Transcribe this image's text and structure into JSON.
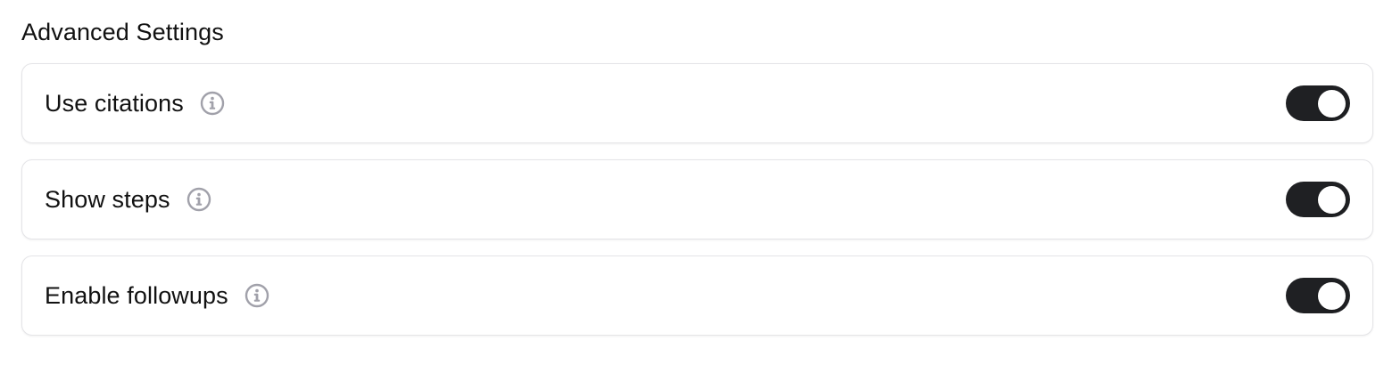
{
  "section": {
    "title": "Advanced Settings"
  },
  "settings": [
    {
      "label": "Use citations",
      "info_icon": "info-icon",
      "enabled": true
    },
    {
      "label": "Show steps",
      "info_icon": "info-icon",
      "enabled": true
    },
    {
      "label": "Enable followups",
      "info_icon": "info-icon",
      "enabled": true
    }
  ],
  "colors": {
    "toggle_on": "#1f2023",
    "toggle_knob": "#ffffff",
    "card_border": "#e4e4e7",
    "info_icon": "#a1a1aa"
  }
}
